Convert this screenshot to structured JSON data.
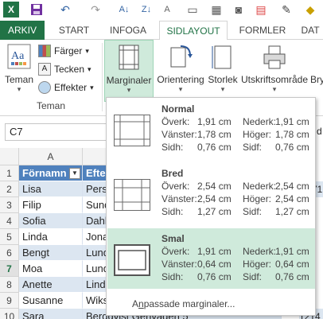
{
  "qat": {
    "icons": [
      "excel-logo-icon",
      "save-icon",
      "undo-icon",
      "redo-icon",
      "sort-icon",
      "sort-desc-icon",
      "font-size-icon",
      "camera-icon",
      "chart-icon",
      "fill-icon"
    ]
  },
  "tabs": {
    "file": "ARKIV",
    "start": "START",
    "insert": "INFOGA",
    "page_layout": "SIDLAYOUT",
    "formulas": "FORMLER",
    "data": "DAT"
  },
  "ribbon": {
    "themes_label": "Teman",
    "colors_label": "Färger",
    "fonts_label": "Tecken",
    "effects_label": "Effekter",
    "margins_label": "Marginaler",
    "orientation_label": "Orientering",
    "size_label": "Storlek",
    "print_area_label": "Utskriftsområde",
    "breaks_label": "Bry",
    "group_themes": "Teman"
  },
  "namebox": {
    "value": "C7"
  },
  "grid": {
    "col_a": "A",
    "header": {
      "row": "1",
      "a": "Förnamn",
      "b": "Efter"
    },
    "rows": [
      {
        "num": "2",
        "a": "Lisa",
        "b": "Pers",
        "peek": "71"
      },
      {
        "num": "3",
        "a": "Filip",
        "b": "Sund",
        "peek": ""
      },
      {
        "num": "4",
        "a": "Sofia",
        "b": "Dahl",
        "peek": ""
      },
      {
        "num": "5",
        "a": "Linda",
        "b": "Jona",
        "peek": ""
      },
      {
        "num": "6",
        "a": "Bengt",
        "b": "Lund",
        "peek": ""
      },
      {
        "num": "7",
        "a": "Moa",
        "b": "Lund",
        "peek": ""
      },
      {
        "num": "8",
        "a": "Anette",
        "b": "Lind",
        "peek": ""
      },
      {
        "num": "9",
        "a": "Susanne",
        "b": "Wiks",
        "peek": ""
      },
      {
        "num": "10",
        "a": "Sara",
        "b": "Bergqvist   Genvägen 5",
        "peek": "1214"
      }
    ]
  },
  "menu": {
    "options": [
      {
        "title": "Normal",
        "top_label": "Överk:",
        "top": "1,91 cm",
        "bottom_label": "Nederk:",
        "bottom": "1,91 cm",
        "left_label": "Vänster:",
        "left": "1,78 cm",
        "right_label": "Höger:",
        "right": "1,78 cm",
        "header_label": "Sidh:",
        "header": "0,76 cm",
        "footer_label": "Sidf:",
        "footer": "0,76 cm"
      },
      {
        "title": "Bred",
        "top_label": "Överk:",
        "top": "2,54 cm",
        "bottom_label": "Nederk:",
        "bottom": "2,54 cm",
        "left_label": "Vänster:",
        "left": "2,54 cm",
        "right_label": "Höger:",
        "right": "2,54 cm",
        "header_label": "Sidh:",
        "header": "1,27 cm",
        "footer_label": "Sidf:",
        "footer": "1,27 cm"
      },
      {
        "title": "Smal",
        "top_label": "Överk:",
        "top": "1,91 cm",
        "bottom_label": "Nederk:",
        "bottom": "1,91 cm",
        "left_label": "Vänster:",
        "left": "0,64 cm",
        "right_label": "Höger:",
        "right": "0,64 cm",
        "header_label": "Sidh:",
        "header": "0,76 cm",
        "footer_label": "Sidf:",
        "footer": "0,76 cm"
      }
    ],
    "custom_prefix": "A",
    "custom_accel": "n",
    "custom_rest": "passade marginaler..."
  },
  "colors": {
    "accent": "#217346",
    "table_header": "#4f81bd",
    "band": "#dce6f1",
    "selected_option": "#cfeadb"
  }
}
